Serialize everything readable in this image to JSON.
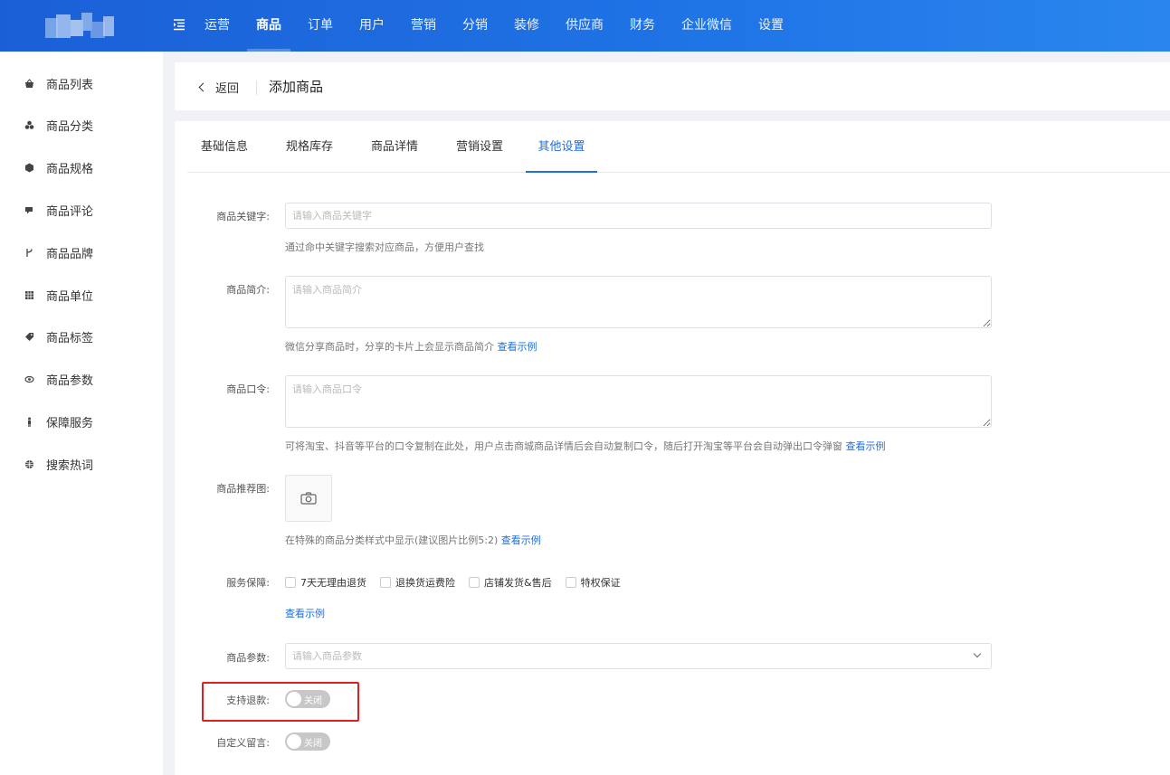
{
  "topnav": {
    "items": [
      "运营",
      "商品",
      "订单",
      "用户",
      "营销",
      "分销",
      "装修",
      "供应商",
      "财务",
      "企业微信",
      "设置"
    ],
    "active_index": 1
  },
  "sidebar": {
    "items": [
      {
        "label": "商品列表",
        "icon": "basket-icon"
      },
      {
        "label": "商品分类",
        "icon": "category-icon"
      },
      {
        "label": "商品规格",
        "icon": "cube-icon"
      },
      {
        "label": "商品评论",
        "icon": "comment-icon"
      },
      {
        "label": "商品品牌",
        "icon": "brand-icon"
      },
      {
        "label": "商品单位",
        "icon": "grid-icon"
      },
      {
        "label": "商品标签",
        "icon": "tag-icon"
      },
      {
        "label": "商品参数",
        "icon": "eye-icon"
      },
      {
        "label": "保障服务",
        "icon": "person-icon"
      },
      {
        "label": "搜索热词",
        "icon": "globe-icon"
      }
    ]
  },
  "header": {
    "back_label": "返回",
    "title": "添加商品"
  },
  "tabs": [
    "基础信息",
    "规格库存",
    "商品详情",
    "营销设置",
    "其他设置"
  ],
  "form": {
    "keyword": {
      "label": "商品关键字:",
      "placeholder": "请输入商品关键字",
      "hint": "通过命中关键字搜索对应商品，方便用户查找"
    },
    "intro": {
      "label": "商品简介:",
      "placeholder": "请输入商品简介",
      "hint": "微信分享商品时，分享的卡片上会显示商品简介",
      "hint_link": "查看示例"
    },
    "password": {
      "label": "商品口令:",
      "placeholder": "请输入商品口令",
      "hint": "可将淘宝、抖音等平台的口令复制在此处，用户点击商城商品详情后会自动复制口令，随后打开淘宝等平台会自动弹出口令弹窗",
      "hint_link": "查看示例"
    },
    "rec_image": {
      "label": "商品推荐图:",
      "hint": "在特殊的商品分类样式中显示(建议图片比例5:2)",
      "hint_link": "查看示例"
    },
    "service": {
      "label": "服务保障:",
      "options": [
        "7天无理由退货",
        "退换货运费险",
        "店铺发货&售后",
        "特权保证"
      ],
      "link": "查看示例"
    },
    "params": {
      "label": "商品参数:",
      "placeholder": "请输入商品参数"
    },
    "refund": {
      "label": "支持退款:",
      "state": "关闭"
    },
    "message": {
      "label": "自定义留言:",
      "state": "关闭"
    }
  },
  "colors": {
    "primary": "#1f6fe0",
    "highlight": "#e02020"
  }
}
